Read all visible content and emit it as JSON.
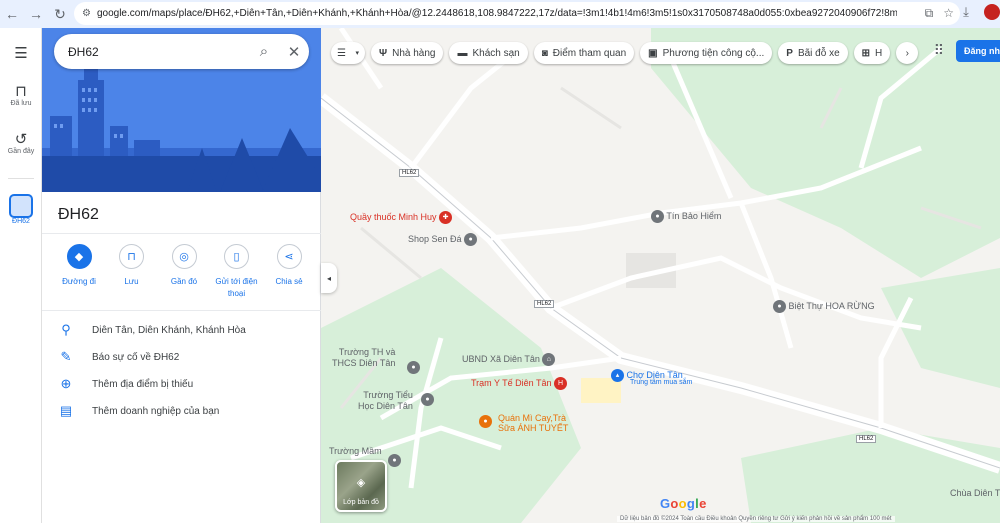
{
  "browser": {
    "url": "google.com/maps/place/ĐH62,+Diên+Tân,+Diên+Khánh,+Khánh+Hòa/@12.2448618,108.9847222,17z/data=!3m1!4b1!4m6!3m5!1s0x3170508748a0d055:0xbea9272040906f72!8m2!3d12.24..."
  },
  "rail": {
    "saved_label": "Đã lưu",
    "recent_label": "Gần đây",
    "current_label": "ĐH62"
  },
  "panel": {
    "search_value": "ĐH62",
    "title": "ĐH62",
    "actions": [
      {
        "label": "Đường đi",
        "icon": "directions-icon"
      },
      {
        "label": "Lưu",
        "icon": "bookmark-icon"
      },
      {
        "label": "Gần đó",
        "icon": "nearby-icon"
      },
      {
        "label": "Gửi tới điện thoại",
        "icon": "send-to-phone-icon"
      },
      {
        "label": "Chia sẻ",
        "icon": "share-icon"
      }
    ],
    "info": [
      {
        "text": "Diên Tân, Diên Khánh, Khánh Hòa",
        "icon": "location-pin-icon"
      },
      {
        "text": "Báo sự cố về ĐH62",
        "icon": "edit-pencil-icon"
      },
      {
        "text": "Thêm địa điểm bị thiếu",
        "icon": "add-place-icon"
      },
      {
        "text": "Thêm doanh nghiệp của bạn",
        "icon": "add-business-icon"
      }
    ]
  },
  "map": {
    "chips": [
      {
        "label": "Nhà hàng",
        "icon": "restaurant-icon"
      },
      {
        "label": "Khách sạn",
        "icon": "hotel-icon"
      },
      {
        "label": "Điểm tham quan",
        "icon": "camera-icon"
      },
      {
        "label": "Phương tiện công cộ...",
        "icon": "transit-icon"
      },
      {
        "label": "Bãi đỗ xe",
        "icon": "parking-icon"
      },
      {
        "label": "H",
        "icon": "pharmacy-icon"
      }
    ],
    "signin_label": "Đăng nhập",
    "road_labels": [
      "HL62",
      "HL62",
      "HL62"
    ],
    "pois": [
      {
        "name": "Quầy thuốc Minh Huy",
        "color": "#d93025"
      },
      {
        "name": "Shop Sen Đá",
        "color": "#70757a"
      },
      {
        "name": "Tín Bảo Hiểm",
        "color": "#70757a"
      },
      {
        "name": "Biệt Thự HOA RỪNG",
        "color": "#70757a"
      },
      {
        "name": "UBND Xã Diên Tân",
        "color": "#70757a"
      },
      {
        "name": "Trạm Y Tế Diên Tân",
        "color": "#d93025"
      },
      {
        "name": "Chợ Diên Tân",
        "color": "#1a73e8"
      },
      {
        "name": "Trung tâm mua sắm",
        "color": "#1a73e8"
      },
      {
        "name": "Quán Mì Cay,Trà",
        "color": "#e8710a"
      },
      {
        "name": "Sữa ÁNH TUYẾT",
        "color": "#e8710a"
      },
      {
        "name": "Trường TH và",
        "color": "#70757a"
      },
      {
        "name": "THCS Diên Tân",
        "color": "#70757a"
      },
      {
        "name": "Trường Tiểu",
        "color": "#70757a"
      },
      {
        "name": "Học Diên Tân",
        "color": "#70757a"
      },
      {
        "name": "Trường Mầm",
        "color": "#70757a"
      },
      {
        "name": "Chùa Diên T",
        "color": "#70757a"
      }
    ],
    "layers_label": "Lớp bản đồ",
    "google_logo": "Google",
    "footer": "Dữ liệu bản đồ ©2024   Toàn cầu   Điều khoản   Quyền riêng tư   Gửi ý kiến phản hồi về sản phẩm   100 mét"
  }
}
